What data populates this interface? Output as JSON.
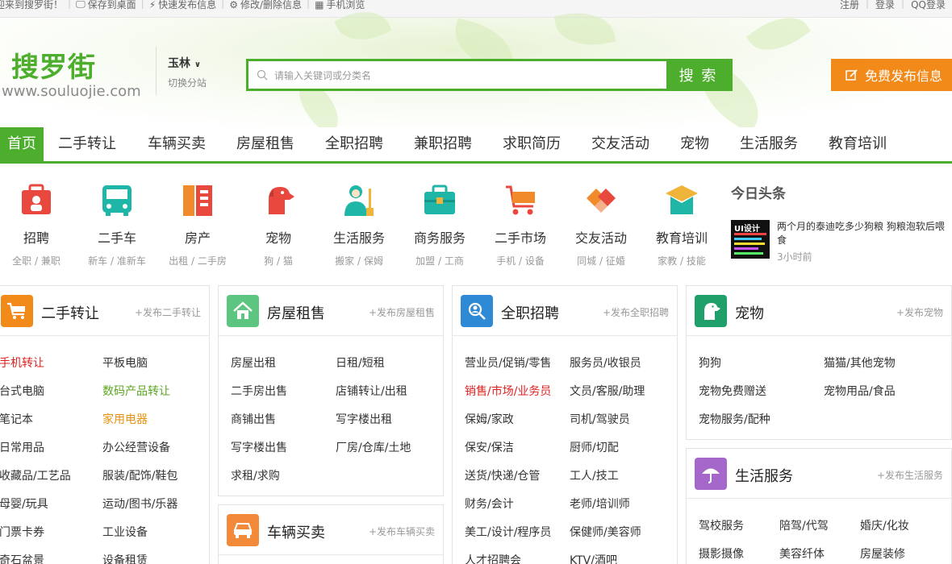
{
  "topbar": {
    "welcome": "迎来到搜罗街！",
    "save_desktop": "保存到桌面",
    "quick_post": "快速发布信息",
    "edit_delete": "修改/删除信息",
    "mobile": "手机浏览",
    "register": "注册",
    "login": "登录",
    "qq_login": "QQ登录"
  },
  "header": {
    "logo_cn": "搜罗街",
    "logo_url": "www.souluojie.com",
    "city": "玉林",
    "switch_city": "切换分站",
    "search_placeholder": "请输入关键词或分类名",
    "search_button": "搜 索",
    "post_button": "免费发布信息"
  },
  "nav": {
    "items": [
      "首页",
      "二手转让",
      "车辆买卖",
      "房屋租售",
      "全职招聘",
      "兼职招聘",
      "求职简历",
      "交友活动",
      "宠物",
      "生活服务",
      "教育培训"
    ]
  },
  "categories": [
    {
      "title": "招聘",
      "sub": "全职 / 兼职",
      "icon": "briefcase-icon"
    },
    {
      "title": "二手车",
      "sub": "新车 / 准新车",
      "icon": "bus-icon"
    },
    {
      "title": "房产",
      "sub": "出租 / 二手房",
      "icon": "building-icon"
    },
    {
      "title": "宠物",
      "sub": "狗 / 猫",
      "icon": "dog-icon"
    },
    {
      "title": "生活服务",
      "sub": "搬家 / 保姆",
      "icon": "cleaner-icon"
    },
    {
      "title": "商务服务",
      "sub": "加盟 / 工商",
      "icon": "toolbox-icon"
    },
    {
      "title": "二手市场",
      "sub": "手机 / 设备",
      "icon": "cart-icon"
    },
    {
      "title": "交友活动",
      "sub": "同城 / 征婚",
      "icon": "handshake-icon"
    },
    {
      "title": "教育培训",
      "sub": "家教 / 技能",
      "icon": "graduation-cap-icon"
    }
  ],
  "headline": {
    "title": "今日头条",
    "news_text": "两个月的泰迪吃多少狗粮 狗粮泡软后喂食",
    "news_time": "3小时前",
    "thumb_text": "UI设计"
  },
  "panels": {
    "secondhand": {
      "title": "二手转让",
      "link": "+发布二手转让",
      "items": [
        "手机转让",
        "平板电脑",
        "台式电脑",
        "数码产品转让",
        "笔记本",
        "家用电器",
        "日常用品",
        "办公经营设备",
        "收藏品/工艺品",
        "服装/配饰/鞋包",
        "母婴/玩具",
        "运动/图书/乐器",
        "门票卡券",
        "工业设备",
        "奇石盆景",
        "设备租赁"
      ]
    },
    "house": {
      "title": "房屋租售",
      "link": "+发布房屋租售",
      "items": [
        "房屋出租",
        "日租/短租",
        "二手房出售",
        "店铺转让/出租",
        "商铺出售",
        "写字楼出租",
        "写字楼出售",
        "厂房/仓库/土地",
        "求租/求购"
      ]
    },
    "vehicle": {
      "title": "车辆买卖",
      "link": "+发布车辆买卖"
    },
    "jobs": {
      "title": "全职招聘",
      "link": "+发布全职招聘",
      "items": [
        "营业员/促销/零售",
        "服务员/收银员",
        "销售/市场/业务员",
        "文员/客服/助理",
        "保姆/家政",
        "司机/驾驶员",
        "保安/保洁",
        "厨师/切配",
        "送货/快递/仓管",
        "工人/技工",
        "财务/会计",
        "老师/培训师",
        "美工/设计/程序员",
        "保健师/美容师",
        "人才招聘会",
        "KTV/酒吧"
      ]
    },
    "pets": {
      "title": "宠物",
      "link": "+发布宠物",
      "items": [
        "狗狗",
        "猫猫/其他宠物",
        "宠物免费赠送",
        "宠物用品/食品",
        "宠物服务/配种"
      ]
    },
    "life": {
      "title": "生活服务",
      "link": "+发布生活服务",
      "items": [
        "驾校服务",
        "陪驾/代驾",
        "婚庆/化妆",
        "摄影摄像",
        "美容纤体",
        "房屋装修"
      ]
    }
  },
  "colors": {
    "brand_green": "#4cae2c",
    "post_orange": "#f28a1a",
    "highlight_red": "#e02020"
  }
}
